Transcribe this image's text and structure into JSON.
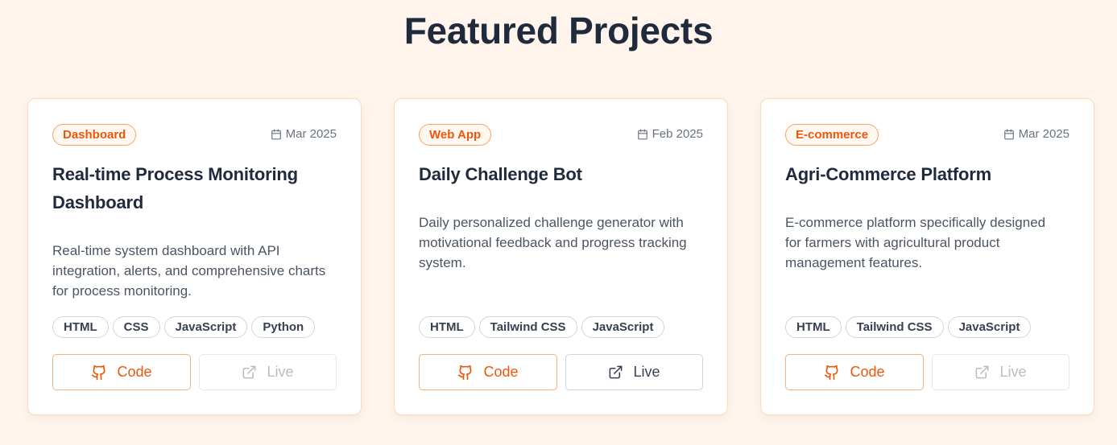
{
  "section": {
    "title": "Featured Projects"
  },
  "colors": {
    "accent": "#ea580c",
    "background": "#fff5ec",
    "heading": "#1f2a3d"
  },
  "projects": [
    {
      "category": "Dashboard",
      "date": "Mar 2025",
      "title": "Real-time Process Monitoring Dashboard",
      "description": "Real-time system dashboard with API integration, alerts, and comprehensive charts for process monitoring.",
      "tags": [
        "HTML",
        "CSS",
        "JavaScript",
        "Python"
      ],
      "code_label": "Code",
      "live_label": "Live",
      "live_enabled": false
    },
    {
      "category": "Web App",
      "date": "Feb 2025",
      "title": "Daily Challenge Bot",
      "description": "Daily personalized challenge generator with motivational feedback and progress tracking system.",
      "tags": [
        "HTML",
        "Tailwind CSS",
        "JavaScript"
      ],
      "code_label": "Code",
      "live_label": "Live",
      "live_enabled": true
    },
    {
      "category": "E-commerce",
      "date": "Mar 2025",
      "title": "Agri-Commerce Platform",
      "description": "E-commerce platform specifically designed for farmers with agricultural product management features.",
      "tags": [
        "HTML",
        "Tailwind CSS",
        "JavaScript"
      ],
      "code_label": "Code",
      "live_label": "Live",
      "live_enabled": false
    }
  ],
  "icons": {
    "date": "calendar-icon",
    "code": "github-icon",
    "live": "external-link-icon"
  }
}
